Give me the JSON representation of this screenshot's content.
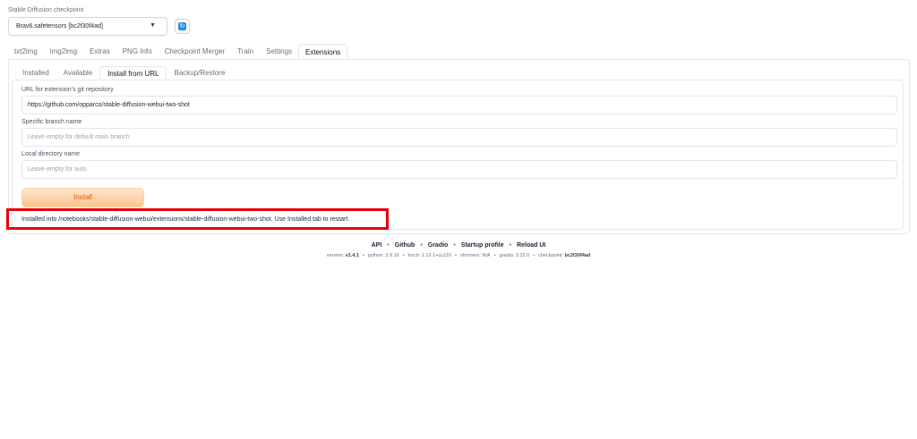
{
  "checkpoint": {
    "label": "Stable Diffusion checkpoint",
    "selected": "Brav6.safetensors [bc2f30f4ad]",
    "caret_icon": "chevron-down-icon",
    "refresh_icon": "refresh-icon"
  },
  "top_tabs": [
    {
      "label": "txt2img",
      "active": false
    },
    {
      "label": "img2img",
      "active": false
    },
    {
      "label": "Extras",
      "active": false
    },
    {
      "label": "PNG Info",
      "active": false
    },
    {
      "label": "Checkpoint Merger",
      "active": false
    },
    {
      "label": "Train",
      "active": false
    },
    {
      "label": "Settings",
      "active": false
    },
    {
      "label": "Extensions",
      "active": true
    }
  ],
  "sub_tabs": [
    {
      "label": "Installed",
      "active": false
    },
    {
      "label": "Available",
      "active": false
    },
    {
      "label": "Install from URL",
      "active": true
    },
    {
      "label": "Backup/Restore",
      "active": false
    }
  ],
  "form": {
    "url_label": "URL for extension's git repository",
    "url_value": "https://github.com/opparco/stable-diffusion-webui-two-shot",
    "branch_label": "Specific branch name",
    "branch_placeholder": "Leave empty for default main branch",
    "dir_label": "Local directory name",
    "dir_placeholder": "Leave empty for auto",
    "install_label": "Install",
    "result": "Installed into /notebooks/stable-diffusion-webui/extensions/stable-diffusion-webui-two-shot. Use Installed tab to restart."
  },
  "highlight_color": "#e8000b",
  "accent_color": "#ea580c",
  "footer": {
    "links": [
      "API",
      "Github",
      "Gradio",
      "Startup profile",
      "Reload UI"
    ],
    "separator": "•",
    "version_label": "version:",
    "version_value": "v1.4.1",
    "python": "python: 3.9.16",
    "torch": "torch: 1.12.1+cu116",
    "xformers": "xformers: N/A",
    "gradio": "gradio: 3.32.0",
    "checkpoint_label": "checkpoint:",
    "checkpoint_value": "bc2f30f4ad"
  }
}
